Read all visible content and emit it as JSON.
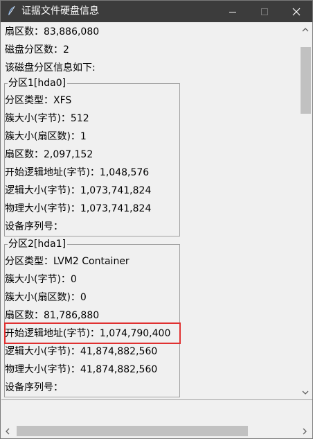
{
  "window": {
    "title": "证据文件硬盘信息"
  },
  "summary": {
    "sector_count": "扇区数：83,886,080",
    "partition_count": "磁盘分区数：2",
    "intro": "该磁盘分区信息如下:"
  },
  "partitions": [
    {
      "title": "分区1[hda0]",
      "lines": [
        "分区类型：XFS",
        "簇大小(字节)：512",
        "簇大小(扇区数)：1",
        "扇区数：2,097,152",
        "开始逻辑地址(字节)：1,048,576",
        "逻辑大小(字节)：1,073,741,824",
        "物理大小(字节)：1,073,741,824",
        "设备序列号："
      ]
    },
    {
      "title": "分区2[hda1]",
      "lines": [
        "分区类型：LVM2 Container",
        "簇大小(字节)：0",
        "簇大小(扇区数)：0",
        "扇区数：81,786,880",
        "开始逻辑地址(字节)：1,074,790,400",
        "逻辑大小(字节)：41,874,882,560",
        "物理大小(字节)：41,874,882,560",
        "设备序列号："
      ]
    }
  ],
  "status": {
    "partial_text": "..."
  },
  "icons": {
    "app": "feather-icon",
    "minimize": "minimize-icon",
    "maximize": "maximize-icon",
    "close": "close-icon"
  },
  "colors": {
    "titlebar": "#3c3c3c",
    "highlight": "#e03030",
    "background": "#f0f0f0"
  }
}
